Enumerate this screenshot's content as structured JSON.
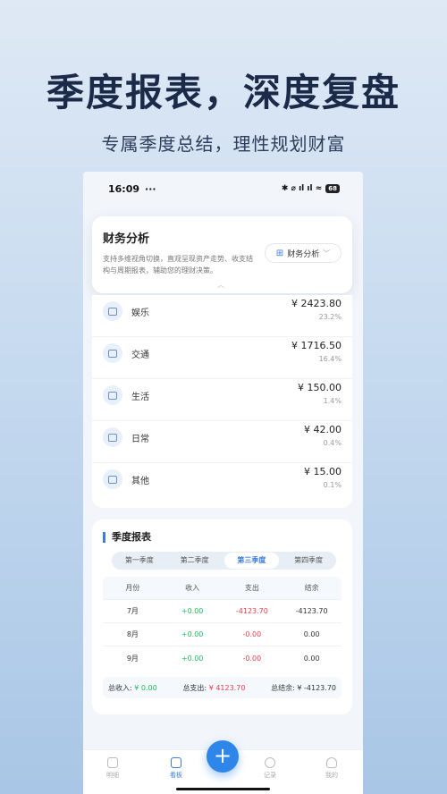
{
  "promo": {
    "title": "季度报表，深度复盘",
    "subtitle": "专属季度总结，理性规划财富"
  },
  "status": {
    "time": "16:09",
    "icons_left": "···",
    "icons_right": "✱ ⌀ ıl ıl ≈",
    "battery": "68"
  },
  "analysis": {
    "title": "财务分析",
    "desc": "支持多维视角切换，直观呈现资产走势、收支结构与周期报表，辅助您的理财决策。",
    "button_label": "财务分析",
    "button_chevron": "﹀",
    "collapse_chevron": "︿"
  },
  "categories": [
    {
      "name": "娱乐",
      "amount": "¥ 2423.80",
      "pct": "23.2%"
    },
    {
      "name": "交通",
      "amount": "¥ 1716.50",
      "pct": "16.4%"
    },
    {
      "name": "生活",
      "amount": "¥ 150.00",
      "pct": "1.4%"
    },
    {
      "name": "日常",
      "amount": "¥ 42.00",
      "pct": "0.4%"
    },
    {
      "name": "其他",
      "amount": "¥ 15.00",
      "pct": "0.1%"
    }
  ],
  "report": {
    "title": "季度报表",
    "tabs": [
      "第一季度",
      "第二季度",
      "第三季度",
      "第四季度"
    ],
    "active_tab": 2,
    "headers": [
      "月份",
      "收入",
      "支出",
      "结余"
    ],
    "rows": [
      [
        "7月",
        "+0.00",
        "-4123.70",
        "-4123.70"
      ],
      [
        "8月",
        "+0.00",
        "-0.00",
        "0.00"
      ],
      [
        "9月",
        "+0.00",
        "-0.00",
        "0.00"
      ]
    ],
    "totals": {
      "income_label": "总收入:",
      "income_value": "¥ 0.00",
      "expense_label": "总支出:",
      "expense_value": "¥ 4123.70",
      "balance_label": "总结余:",
      "balance_value": "¥ -4123.70"
    }
  },
  "tabbar": {
    "items": [
      "明细",
      "看板",
      "记录",
      "我的"
    ],
    "active": 1,
    "fab": "+"
  },
  "colors": {
    "accent": "#3a7bdc",
    "income": "#22b95a",
    "expense": "#e2404a"
  }
}
